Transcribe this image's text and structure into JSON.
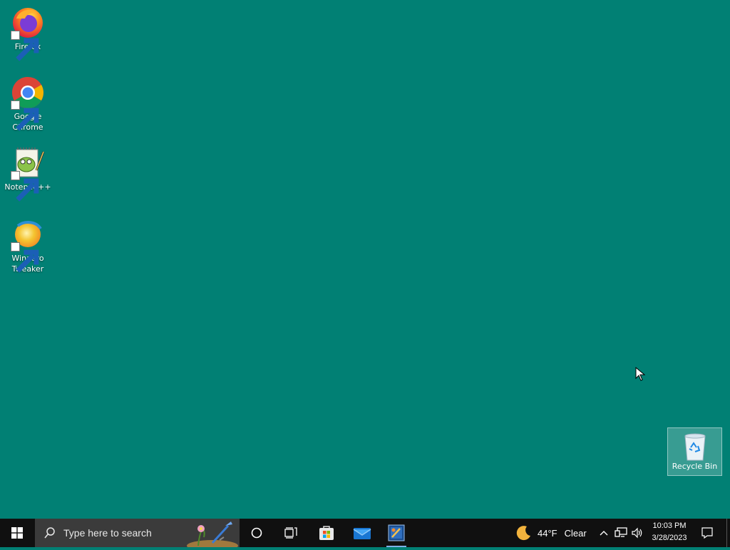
{
  "desktop": {
    "background_color": "#018074",
    "icons": [
      {
        "label": "Firefox",
        "icon": "firefox-icon"
      },
      {
        "label": "Google\nChrome",
        "icon": "chrome-icon"
      },
      {
        "label": "Notepad++",
        "icon": "notepadplusplus-icon"
      },
      {
        "label": "Winaero\nTweaker",
        "icon": "winaero-tweaker-icon"
      }
    ],
    "recycle_bin": {
      "label": "Recycle Bin",
      "icon": "recycle-bin-icon"
    }
  },
  "taskbar": {
    "search": {
      "placeholder": "Type here to search"
    },
    "pinned": [
      {
        "name": "cortana",
        "icon": "cortana-circle-icon"
      },
      {
        "name": "task-view",
        "icon": "task-view-icon"
      },
      {
        "name": "microsoft-store",
        "icon": "store-icon"
      },
      {
        "name": "mail",
        "icon": "mail-icon"
      },
      {
        "name": "winaero-tweaker",
        "icon": "winaero-app-icon"
      }
    ],
    "weather": {
      "temperature": "44°F",
      "condition": "Clear",
      "icon": "moon-icon"
    },
    "tray": {
      "icons": [
        "chevron-up-icon",
        "network-icon",
        "volume-icon"
      ]
    },
    "clock": {
      "time": "10:03 PM",
      "date": "3/28/2023"
    },
    "notification": {
      "icon": "action-center-icon"
    }
  }
}
